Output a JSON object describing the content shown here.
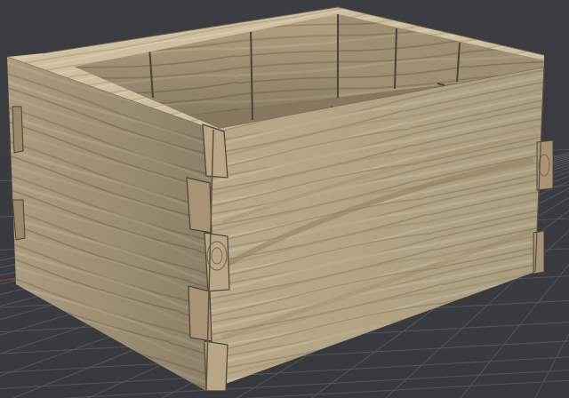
{
  "viewport": {
    "background_color": "#3b3c40",
    "grid_color": "#5a5c62",
    "axis_x_color": "#8a3a3a",
    "model": "dovetailed-wooden-box",
    "wood_light": "#c8b89a",
    "wood_mid": "#b3a07e",
    "wood_dark": "#8c7a5c",
    "seam_color": "#4a4336"
  }
}
